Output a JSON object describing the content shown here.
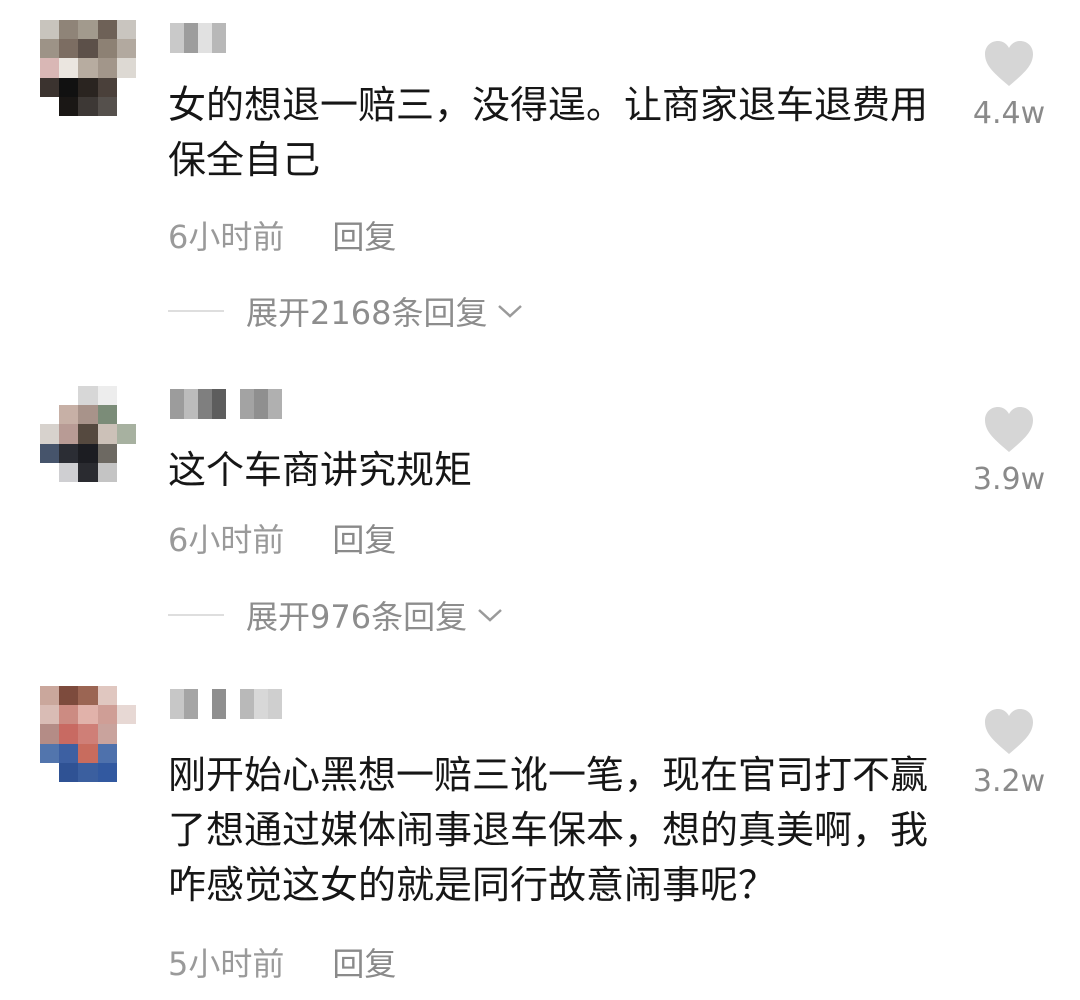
{
  "comments": [
    {
      "text": "女的想退一赔三，没得逞。让商家退车退费用保全自己",
      "time": "6小时前",
      "reply": "回复",
      "expand": "展开2168条回复",
      "likes": "4.4w"
    },
    {
      "text": "这个车商讲究规矩",
      "time": "6小时前",
      "reply": "回复",
      "expand": "展开976条回复",
      "likes": "3.9w"
    },
    {
      "text": "刚开始心黑想一赔三讹一笔，现在官司打不赢了想通过媒体闹事退车保本，想的真美啊，我咋感觉这女的就是同行故意闹事呢？",
      "time": "5小时前",
      "reply": "回复",
      "likes": "3.2w"
    }
  ],
  "icons": {
    "like": "heart-icon",
    "expand": "chevron-down-icon"
  },
  "colors": {
    "heart": "#d6d6d6",
    "meta": "#9a9a9a",
    "text": "#161616"
  }
}
